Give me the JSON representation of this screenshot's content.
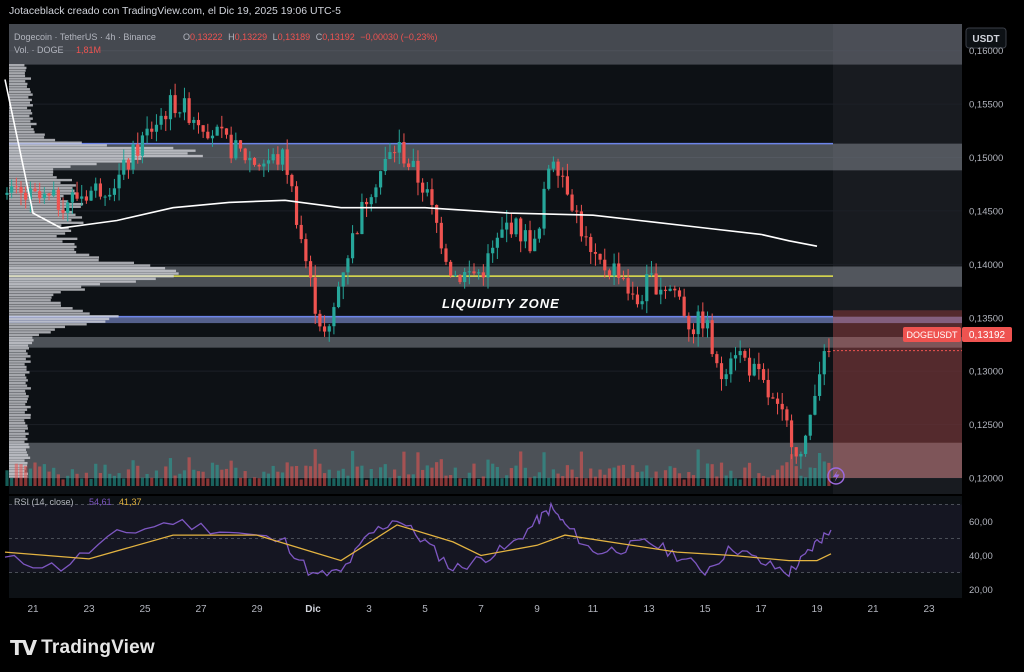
{
  "header": {
    "credit": "Jotaceblack creado con TradingView.com, el Dic 19, 2025 19:06 UTC-5"
  },
  "brand": {
    "name": "TradingView",
    "logo": "TV-logo-icon"
  },
  "colors": {
    "up": "#26a69a",
    "down": "#ef5350",
    "rsi": "#7e57c2",
    "rsi_ma": "#e3b341",
    "poc": "#e5e54d",
    "zone": "#6c84e8",
    "vwap": "#ffffff"
  },
  "price_pane": {
    "legend_title": "Dogecoin · TetherUS · 4h · Binance",
    "ohlc": {
      "O": "0,13222",
      "H": "0,13229",
      "L": "0,13189",
      "C": "0,13192",
      "chg": "−0,00030 (−0,23%)"
    },
    "volume_label": "Vol. · DOGE",
    "volume_value": "1,81M",
    "currency": "USDT",
    "symbol_tag": "DOGEUSDT",
    "last_price": "0,13192",
    "annotation": "LIQUIDITY ZONE",
    "price_ticks": [
      "0,16000",
      "0,15500",
      "0,15000",
      "0,14500",
      "0,14000",
      "0,13500",
      "0,13000",
      "0,12500",
      "0,12000"
    ]
  },
  "rsi_pane": {
    "label": "RSI (14, close)",
    "rsi_value": "54,61",
    "ma_value": "41,37",
    "ticks": [
      "60,00",
      "40,00",
      "20,00"
    ]
  },
  "x_axis": [
    "21",
    "23",
    "25",
    "27",
    "29",
    "Dic",
    "3",
    "5",
    "7",
    "9",
    "11",
    "13",
    "15",
    "17",
    "19",
    "21",
    "23"
  ],
  "chart_data": {
    "type": "candlestick",
    "symbol": "DOGEUSDT",
    "timeframe": "4h",
    "y_range": [
      0.1185,
      0.1625
    ],
    "x_range": [
      "2025-11-20",
      "2025-12-23"
    ],
    "levels": {
      "high_zone": [
        0.1488,
        0.1513
      ],
      "poc_line": 0.1389,
      "poc_zone": [
        0.1379,
        0.1398
      ],
      "liquidity_zone": [
        0.1345,
        0.1351
      ],
      "mid_zone": [
        0.1322,
        0.1332
      ],
      "low_zone": [
        0.12,
        0.1233
      ]
    },
    "vwap": [
      {
        "date": "2025-11-20",
        "v": 0.1573
      },
      {
        "date": "2025-11-21",
        "v": 0.1448
      },
      {
        "date": "2025-11-22",
        "v": 0.1434
      },
      {
        "date": "2025-11-24",
        "v": 0.1441
      },
      {
        "date": "2025-11-26",
        "v": 0.1453
      },
      {
        "date": "2025-11-28",
        "v": 0.1458
      },
      {
        "date": "2025-11-30",
        "v": 0.146
      },
      {
        "date": "2025-12-02",
        "v": 0.1453
      },
      {
        "date": "2025-12-05",
        "v": 0.1453
      },
      {
        "date": "2025-12-08",
        "v": 0.1448
      },
      {
        "date": "2025-12-11",
        "v": 0.1446
      },
      {
        "date": "2025-12-13",
        "v": 0.144
      },
      {
        "date": "2025-12-15",
        "v": 0.1434
      },
      {
        "date": "2025-12-17",
        "v": 0.1428
      },
      {
        "date": "2025-12-18",
        "v": 0.1422
      },
      {
        "date": "2025-12-19",
        "v": 0.1417
      }
    ],
    "price_path": [
      {
        "date": "2025-11-20",
        "v": 0.1465
      },
      {
        "date": "2025-11-22",
        "v": 0.1458
      },
      {
        "date": "2025-11-24",
        "v": 0.1478
      },
      {
        "date": "2025-11-25",
        "v": 0.152
      },
      {
        "date": "2025-11-26",
        "v": 0.1552
      },
      {
        "date": "2025-11-27",
        "v": 0.1535
      },
      {
        "date": "2025-11-28",
        "v": 0.151
      },
      {
        "date": "2025-11-29",
        "v": 0.1495
      },
      {
        "date": "2025-11-30",
        "v": 0.15
      },
      {
        "date": "2025-12-01",
        "v": 0.137
      },
      {
        "date": "2025-12-01T12:00",
        "v": 0.1325
      },
      {
        "date": "2025-12-02",
        "v": 0.1392
      },
      {
        "date": "2025-12-03",
        "v": 0.147
      },
      {
        "date": "2025-12-04",
        "v": 0.1512
      },
      {
        "date": "2025-12-05",
        "v": 0.147
      },
      {
        "date": "2025-12-06",
        "v": 0.139
      },
      {
        "date": "2025-12-07",
        "v": 0.1392
      },
      {
        "date": "2025-12-08",
        "v": 0.144
      },
      {
        "date": "2025-12-09",
        "v": 0.1415
      },
      {
        "date": "2025-12-09T12:00",
        "v": 0.1508
      },
      {
        "date": "2025-12-10",
        "v": 0.148
      },
      {
        "date": "2025-12-11",
        "v": 0.14
      },
      {
        "date": "2025-12-12",
        "v": 0.1395
      },
      {
        "date": "2025-12-12T12:00",
        "v": 0.136
      },
      {
        "date": "2025-12-13",
        "v": 0.1385
      },
      {
        "date": "2025-12-14",
        "v": 0.1375
      },
      {
        "date": "2025-12-14T12:00",
        "v": 0.134
      },
      {
        "date": "2025-12-15",
        "v": 0.135
      },
      {
        "date": "2025-12-15T12:00",
        "v": 0.129
      },
      {
        "date": "2025-12-16",
        "v": 0.1325
      },
      {
        "date": "2025-12-17",
        "v": 0.129
      },
      {
        "date": "2025-12-17T12:00",
        "v": 0.1265
      },
      {
        "date": "2025-12-18",
        "v": 0.1245
      },
      {
        "date": "2025-12-18T12:00",
        "v": 0.1215
      },
      {
        "date": "2025-12-19",
        "v": 0.13
      },
      {
        "date": "2025-12-19T12:00",
        "v": 0.1319
      }
    ],
    "rsi_path": [
      {
        "date": "2025-11-20",
        "v": 38
      },
      {
        "date": "2025-11-22",
        "v": 33
      },
      {
        "date": "2025-11-24",
        "v": 52
      },
      {
        "date": "2025-11-26",
        "v": 60
      },
      {
        "date": "2025-11-28",
        "v": 54
      },
      {
        "date": "2025-11-30",
        "v": 48
      },
      {
        "date": "2025-12-01",
        "v": 28
      },
      {
        "date": "2025-12-02",
        "v": 30
      },
      {
        "date": "2025-12-03",
        "v": 52
      },
      {
        "date": "2025-12-04",
        "v": 62
      },
      {
        "date": "2025-12-05",
        "v": 48
      },
      {
        "date": "2025-12-06",
        "v": 32
      },
      {
        "date": "2025-12-07",
        "v": 38
      },
      {
        "date": "2025-12-08",
        "v": 45
      },
      {
        "date": "2025-12-09",
        "v": 60
      },
      {
        "date": "2025-12-09T12:00",
        "v": 68
      },
      {
        "date": "2025-12-10",
        "v": 58
      },
      {
        "date": "2025-12-11",
        "v": 42
      },
      {
        "date": "2025-12-12",
        "v": 44
      },
      {
        "date": "2025-12-13",
        "v": 48
      },
      {
        "date": "2025-12-14",
        "v": 40
      },
      {
        "date": "2025-12-15",
        "v": 31
      },
      {
        "date": "2025-12-16",
        "v": 45
      },
      {
        "date": "2025-12-17",
        "v": 36
      },
      {
        "date": "2025-12-18",
        "v": 30
      },
      {
        "date": "2025-12-18T12:00",
        "v": 38
      },
      {
        "date": "2025-12-19",
        "v": 48
      },
      {
        "date": "2025-12-19T12:00",
        "v": 55
      }
    ],
    "rsi_ma_path": [
      {
        "date": "2025-11-20",
        "v": 42
      },
      {
        "date": "2025-11-23",
        "v": 38
      },
      {
        "date": "2025-11-26",
        "v": 52
      },
      {
        "date": "2025-11-29",
        "v": 52
      },
      {
        "date": "2025-12-01",
        "v": 42
      },
      {
        "date": "2025-12-02",
        "v": 37
      },
      {
        "date": "2025-12-04",
        "v": 58
      },
      {
        "date": "2025-12-06",
        "v": 48
      },
      {
        "date": "2025-12-07",
        "v": 40
      },
      {
        "date": "2025-12-09",
        "v": 46
      },
      {
        "date": "2025-12-10",
        "v": 52
      },
      {
        "date": "2025-12-12",
        "v": 47
      },
      {
        "date": "2025-12-14",
        "v": 42
      },
      {
        "date": "2025-12-16",
        "v": 40
      },
      {
        "date": "2025-12-18",
        "v": 37
      },
      {
        "date": "2025-12-19",
        "v": 37
      },
      {
        "date": "2025-12-19T12:00",
        "v": 41
      }
    ],
    "rsi_range": [
      15,
      75
    ],
    "rsi_bands": [
      70,
      50,
      30
    ],
    "current": {
      "close": 0.13192,
      "rsi": 54.61,
      "rsi_ma": 41.37
    }
  }
}
